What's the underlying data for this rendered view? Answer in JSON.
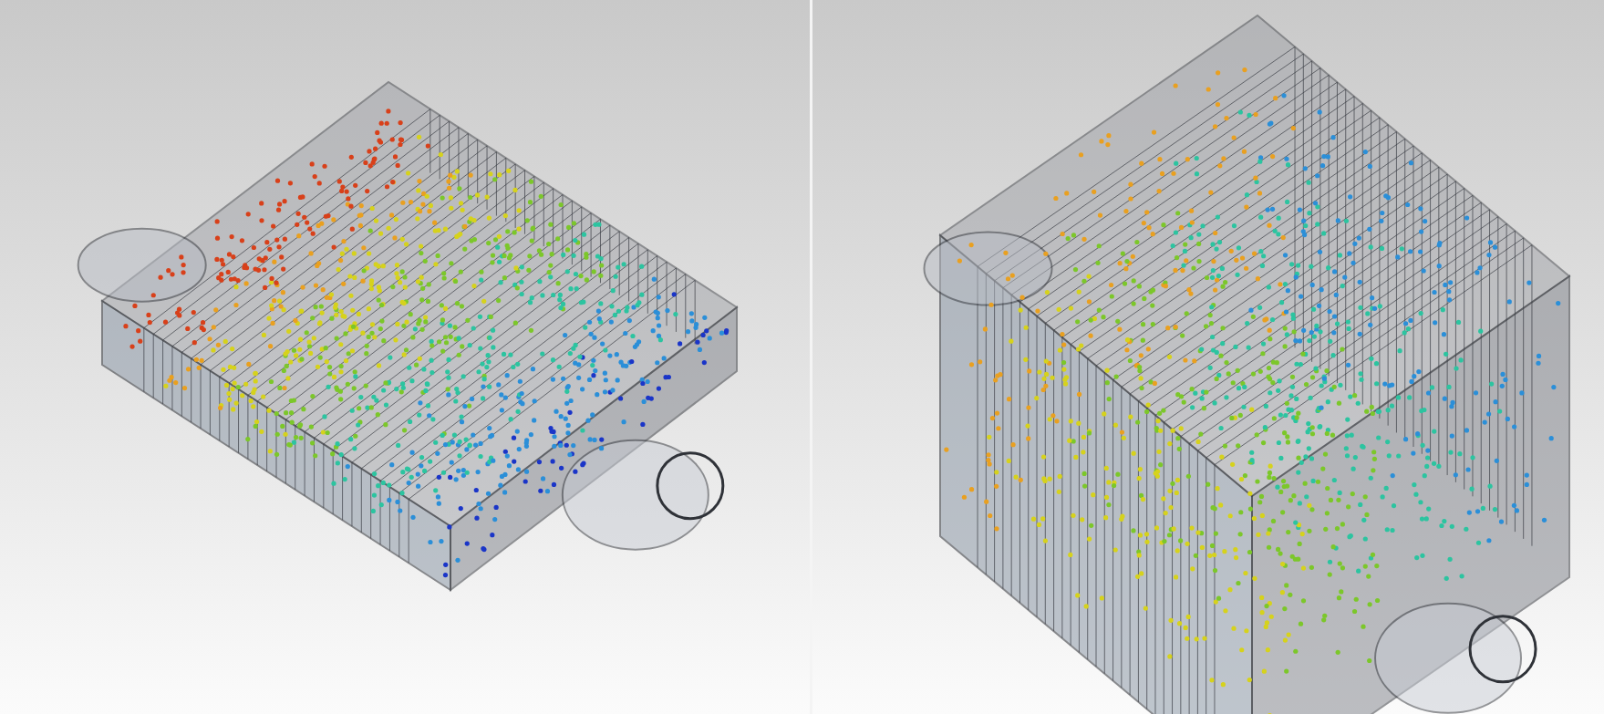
{
  "views": [
    {
      "kind": "particle-render"
    },
    {
      "kind": "particle-render"
    }
  ]
}
